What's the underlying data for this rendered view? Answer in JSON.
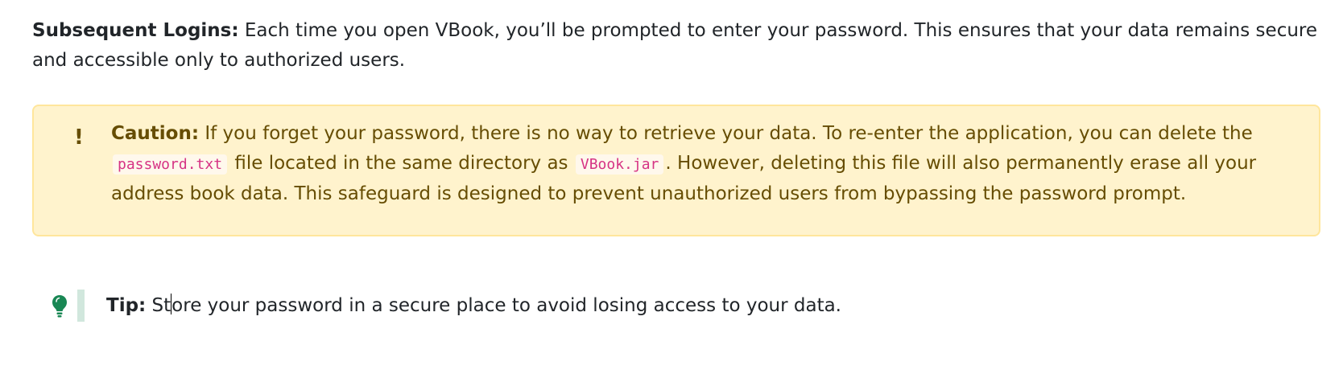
{
  "subsequent": {
    "label": "Subsequent Logins:",
    "text": "Each time you open VBook, you’ll be prompted to enter your password. This ensures that your data remains secure and accessible only to authorized users."
  },
  "caution": {
    "icon": "exclamation-icon",
    "icon_glyph": "!",
    "label": "Caution:",
    "text_1": "If you forget your password, there is no way to retrieve your data. To re-enter the application, you can delete the",
    "code_1": "password.txt",
    "text_2": "file located in the same directory as",
    "code_2": "VBook.jar",
    "text_3": ". However, deleting this file will also permanently erase all your address book data. This safeguard is designed to prevent unauthorized users from bypassing the password prompt.",
    "background_color": "#fff3cd",
    "text_color": "#664d03"
  },
  "tip": {
    "icon": "lightbulb-icon",
    "label": "Tip:",
    "text_before_caret": "St",
    "text_after_caret": "ore your password in a secure place to avoid losing access to your data.",
    "icon_color": "#198754",
    "bar_color": "#d1e7dd"
  }
}
